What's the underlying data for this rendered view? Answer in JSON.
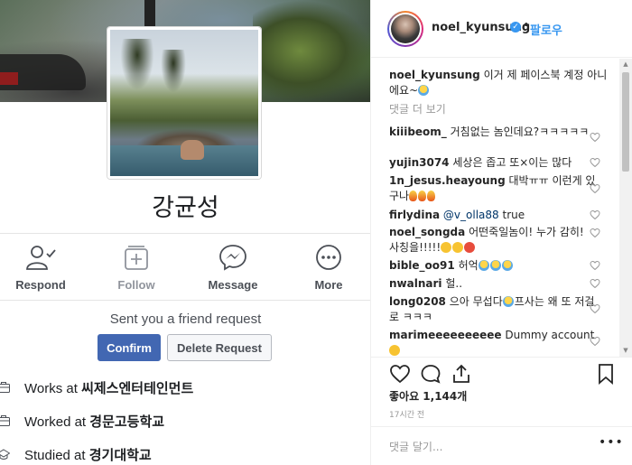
{
  "fb_profile": {
    "name": "강균성",
    "actions": [
      {
        "label": "Respond",
        "icon": "person-check-icon"
      },
      {
        "label": "Follow",
        "icon": "follow-plus-icon"
      },
      {
        "label": "Message",
        "icon": "messenger-icon"
      },
      {
        "label": "More",
        "icon": "more-circle-icon"
      }
    ],
    "request_text": "Sent you a friend request",
    "confirm_label": "Confirm",
    "delete_label": "Delete Request",
    "about": [
      {
        "prefix": "Works at ",
        "bold": "씨제스엔터테인먼트",
        "icon": "briefcase-icon"
      },
      {
        "prefix": "Worked at ",
        "bold": "경문고등학교",
        "icon": "briefcase-icon"
      },
      {
        "prefix": "Studied at ",
        "bold": "경기대학교",
        "icon": "graduation-cap-icon"
      }
    ]
  },
  "header": {
    "username": "noel_kyunsung",
    "separator": "•",
    "follow_label": "팔로우"
  },
  "caption": {
    "username": "noel_kyunsung",
    "text": "이거 제 페이스북 계정 아니에요~"
  },
  "load_more": "댓글 더 보기",
  "comments": [
    {
      "user": "kiiibeom_",
      "text": "거침없는 놈인데요?ㅋㅋㅋㅋㅋ"
    },
    {
      "user": "yujin3074",
      "text": "세상은 좁고 또×이는 많다"
    },
    {
      "user": "1n_jesus.heayoung",
      "text": "대박ㅠㅠ 이런게 있구나"
    },
    {
      "user": "firlydina",
      "mention": "@v_olla88",
      "text": "true"
    },
    {
      "user": "noel_songda",
      "text": "어떤죽일놈이! 누가 감히! 사칭을!!!!!"
    },
    {
      "user": "bible_oo91",
      "text": "허억"
    },
    {
      "user": "nwalnari",
      "text": "헐.."
    },
    {
      "user": "long0208",
      "text": "으아 무섭다",
      "text2": "프사는 왜 또 저걸로 ㅋㅋㅋ"
    },
    {
      "user": "marimeeeeeeeeee",
      "text": "Dummy account"
    }
  ],
  "likes_text": "좋아요 1,144개",
  "time_text": "17시간 전",
  "comment_placeholder": "댓글 달기...",
  "more_label": "•••",
  "colors": {
    "instagram_blue": "#3897f0",
    "facebook_blue": "#4267b2"
  }
}
